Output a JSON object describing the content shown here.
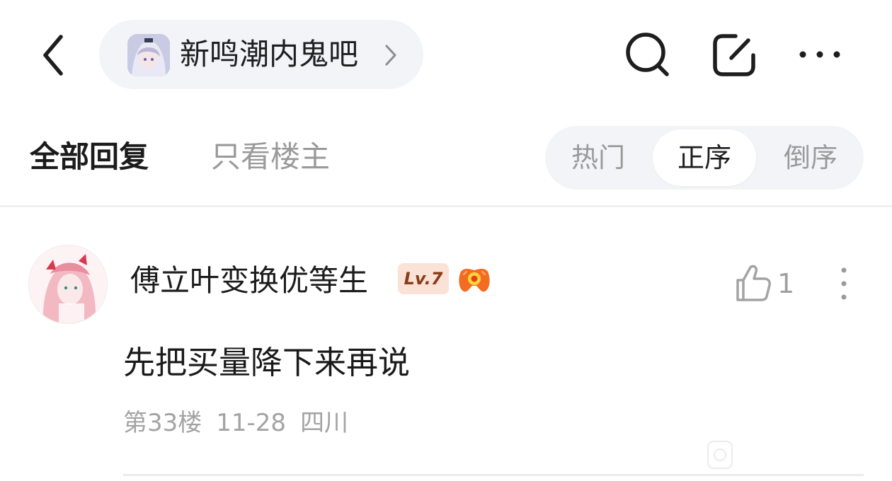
{
  "header": {
    "forum_name": "新鸣潮内鬼吧"
  },
  "tabs": {
    "all_replies": "全部回复",
    "op_only": "只看楼主"
  },
  "sort": {
    "options": [
      "热门",
      "正序",
      "倒序"
    ],
    "selected": "正序"
  },
  "post": {
    "username": "傅立叶变换优等生",
    "level": "Lv.7",
    "likes": "1",
    "content": "先把买量降下来再说",
    "floor": "第33楼",
    "date": "11-28",
    "location": "四川"
  },
  "colors": {
    "pill_background": "#f3f4f8",
    "muted_text": "#9a9a9a",
    "level_badge_bg": "#fbe2d6",
    "level_badge_text": "#8a3b17"
  }
}
